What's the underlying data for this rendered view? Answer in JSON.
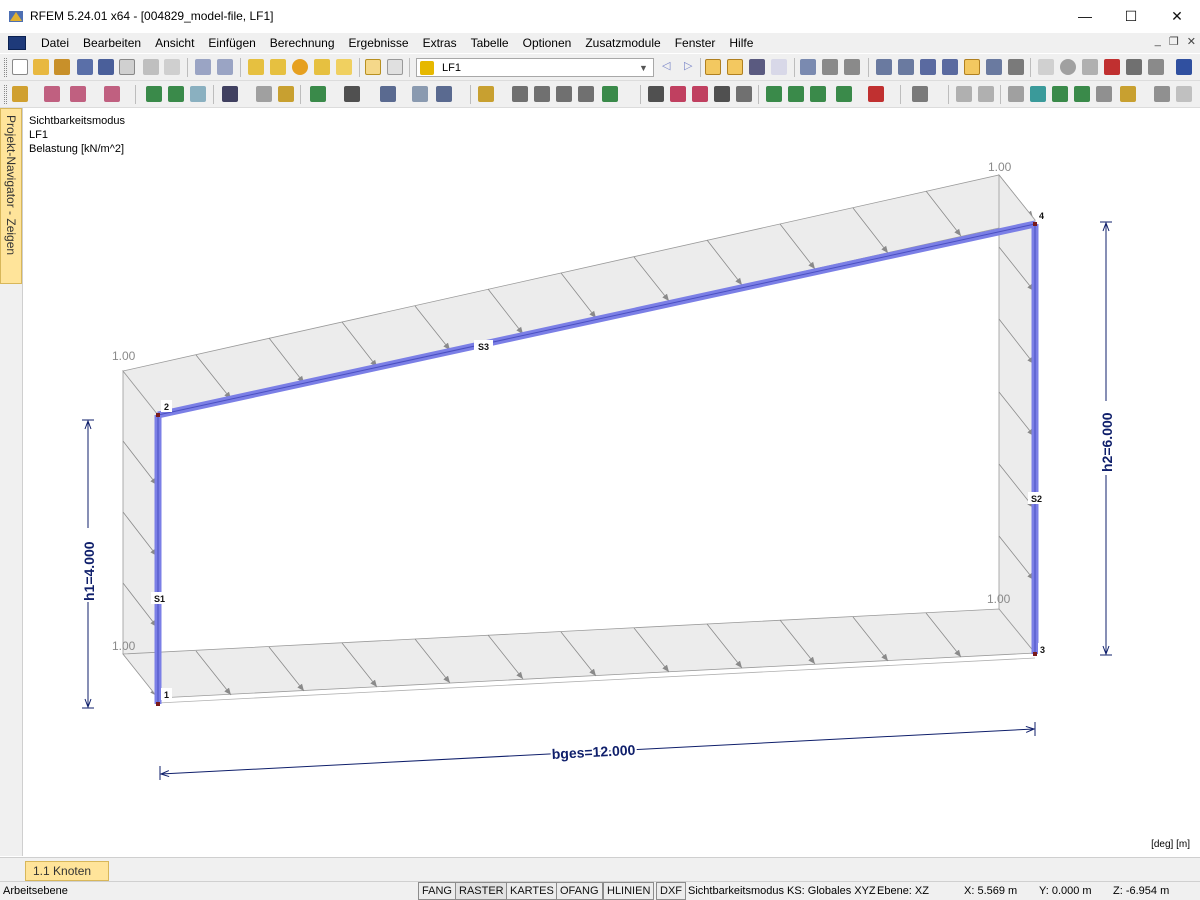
{
  "window": {
    "title": "RFEM 5.24.01 x64 - [004829_model-file, LF1]",
    "minimize_glyph": "—",
    "maximize_glyph": "☐",
    "close_glyph": "✕"
  },
  "menu": {
    "items": [
      "Datei",
      "Bearbeiten",
      "Ansicht",
      "Einfügen",
      "Berechnung",
      "Ergebnisse",
      "Extras",
      "Tabelle",
      "Optionen",
      "Zusatzmodule",
      "Fenster",
      "Hilfe"
    ],
    "mdi_minimize": "_",
    "mdi_restore": "❐",
    "mdi_close": "✕"
  },
  "toolbar": {
    "load_case_value": "LF1",
    "prev_label": "◁",
    "next_label": "▷"
  },
  "navigator": {
    "tab_label": "Projekt-Navigator - Zeigen"
  },
  "viewport": {
    "info_lines": [
      "Sichtbarkeitsmodus",
      "LF1",
      "Belastung [kN/m^2]"
    ],
    "units": "[deg] [m]",
    "load_value_labels": [
      "1.00",
      "1.00",
      "1.00",
      "1.00"
    ],
    "node_labels": [
      "1",
      "2",
      "3",
      "4"
    ],
    "member_labels": [
      "S1",
      "S2",
      "S3"
    ],
    "dimensions": {
      "h1": "h1=4.000",
      "h2": "h2=6.000",
      "bges": "bges=12.000"
    },
    "colors": {
      "member": "#7b7fe6",
      "member_edge": "#4a4fc0",
      "load_fill": "#ececec",
      "dimension": "#0f1f6b",
      "node": "#7a1a1a"
    }
  },
  "bottom_tab": {
    "label": "1.1 Knoten"
  },
  "statusbar": {
    "left_text": "Arbeitsebene",
    "buttons": [
      "FANG",
      "RASTER",
      "KARTES",
      "OFANG",
      "HLINIEN",
      "DXF"
    ],
    "mode": "Sichtbarkeitsmodus",
    "ks": "KS: Globales XYZ",
    "ebene": "Ebene: XZ",
    "x": "X:  5.569 m",
    "y": "Y:  0.000 m",
    "z": "Z:  -6.954 m"
  }
}
